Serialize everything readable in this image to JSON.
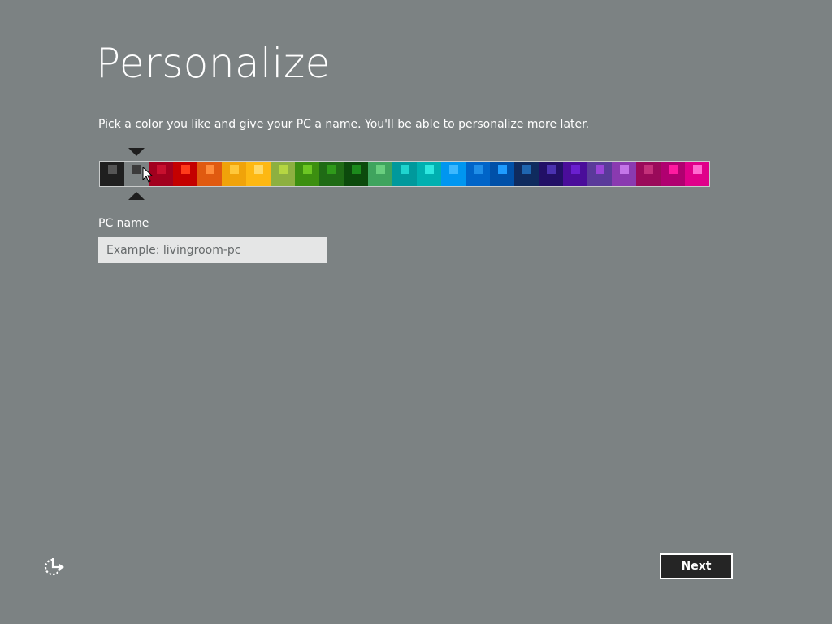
{
  "page": {
    "title": "Personalize",
    "instructions": "Pick a color you like and give your PC a name. You'll be able to personalize more later."
  },
  "colors": {
    "selected_index": 1,
    "swatches": [
      {
        "bg": "#1f1f1f",
        "chip": "#555555"
      },
      {
        "bg": "#7c8283",
        "chip": "#3b3b3b"
      },
      {
        "bg": "#a2001e",
        "chip": "#c8102e"
      },
      {
        "bg": "#c40000",
        "chip": "#ff3b1a"
      },
      {
        "bg": "#e05a10",
        "chip": "#ff8c3a"
      },
      {
        "bg": "#f0a30a",
        "chip": "#ffc83a"
      },
      {
        "bg": "#fdb813",
        "chip": "#ffd966"
      },
      {
        "bg": "#8db040",
        "chip": "#b5d642"
      },
      {
        "bg": "#3c8f10",
        "chip": "#6cc623"
      },
      {
        "bg": "#1f6b15",
        "chip": "#2f9a1a"
      },
      {
        "bg": "#0c4a0c",
        "chip": "#1c8a1c"
      },
      {
        "bg": "#3fa45e",
        "chip": "#69cf7f"
      },
      {
        "bg": "#00999c",
        "chip": "#1fd4cf"
      },
      {
        "bg": "#00b0b0",
        "chip": "#2ee8e0"
      },
      {
        "bg": "#0096f0",
        "chip": "#3cb8ff"
      },
      {
        "bg": "#0064c8",
        "chip": "#1f8ee8"
      },
      {
        "bg": "#0050a8",
        "chip": "#1e9cff"
      },
      {
        "bg": "#0f2b5e",
        "chip": "#1f66b0"
      },
      {
        "bg": "#221066",
        "chip": "#4a32b0"
      },
      {
        "bg": "#4a0d9a",
        "chip": "#6a1fcf"
      },
      {
        "bg": "#5a3a9a",
        "chip": "#9a44d8"
      },
      {
        "bg": "#8a3ab0",
        "chip": "#c476e8"
      },
      {
        "bg": "#9a0a5a",
        "chip": "#c4307a"
      },
      {
        "bg": "#b00070",
        "chip": "#ff1aa0"
      },
      {
        "bg": "#e0008a",
        "chip": "#ff6ad0"
      }
    ]
  },
  "pc_name": {
    "label": "PC name",
    "placeholder": "Example: livingroom-pc",
    "value": ""
  },
  "footer": {
    "next_label": "Next",
    "ease_of_access_icon": "ease-of-access-icon"
  }
}
